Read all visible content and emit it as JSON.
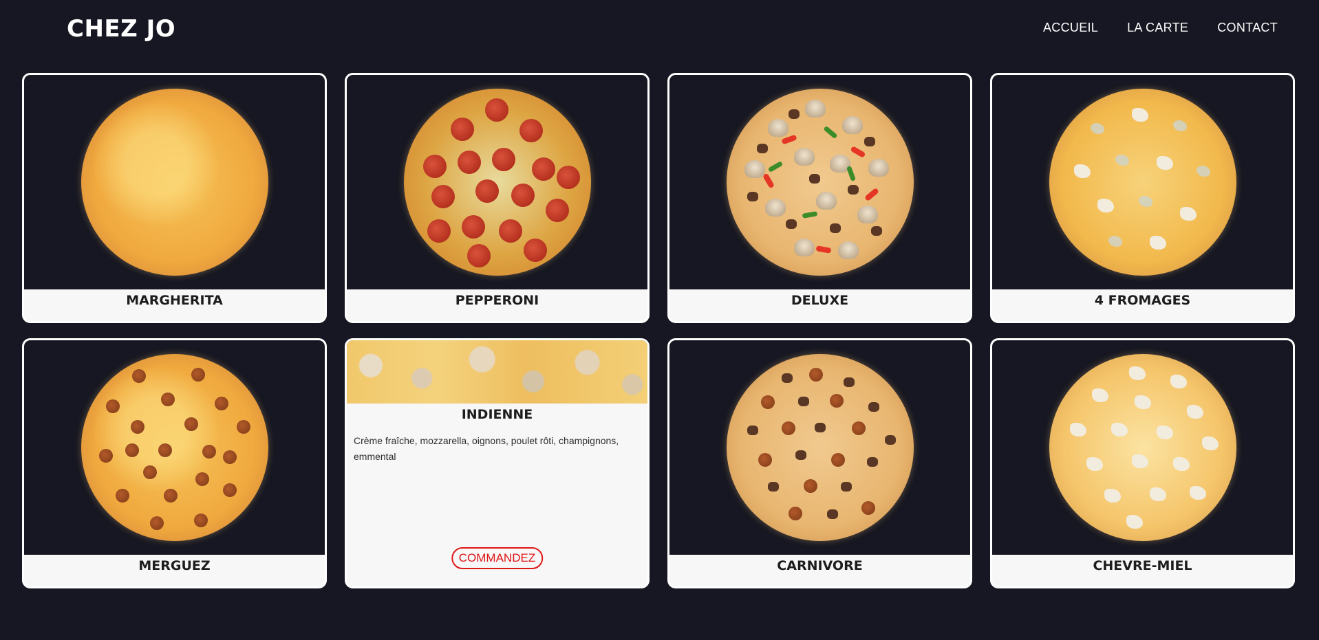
{
  "header": {
    "logo": "CHEZ JO",
    "nav": [
      "ACCUEIL",
      "LA CARTE",
      "CONTACT"
    ]
  },
  "pizzas": [
    {
      "name": "MARGHERITA",
      "image": "pizza-margherita-image"
    },
    {
      "name": "PEPPERONI",
      "image": "pizza-pepperoni-image"
    },
    {
      "name": "DELUXE",
      "image": "pizza-deluxe-image"
    },
    {
      "name": "4 FROMAGES",
      "image": "pizza-4-fromages-image"
    },
    {
      "name": "MERGUEZ",
      "image": "pizza-merguez-image"
    },
    {
      "name": "INDIENNE",
      "image": "pizza-indienne-banner-image",
      "description": "Crème fraîche, mozzarella, oignons, poulet rôti, champignons, emmental",
      "order_label": "COMMANDEZ"
    },
    {
      "name": "CARNIVORE",
      "image": "pizza-carnivore-image"
    },
    {
      "name": "CHEVRE-MIEL",
      "image": "pizza-chevre-miel-image"
    }
  ],
  "colors": {
    "background": "#161722",
    "card": "#f7f7f7",
    "accent": "#e01515"
  }
}
